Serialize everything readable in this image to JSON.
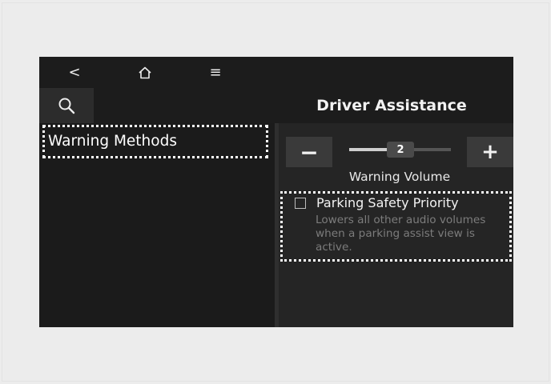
{
  "nav": {
    "back_icon": "chevron-left-icon",
    "home_icon": "home-icon",
    "menu_icon": "hamburger-menu-icon",
    "back_glyph": "<",
    "menu_glyph": "≡"
  },
  "header": {
    "search_icon": "search-icon",
    "title": "Driver Assistance"
  },
  "sidebar": {
    "items": [
      {
        "label": "Warning Methods",
        "selected": true
      }
    ]
  },
  "volume": {
    "minus_label": "−",
    "plus_label": "+",
    "value": "2",
    "level_fraction": 0.5,
    "label": "Warning Volume"
  },
  "options": {
    "parking_priority": {
      "label": "Parking Safety Priority",
      "checked": false,
      "description": "Lowers all other audio volumes when a parking assist view is active."
    }
  },
  "colors": {
    "screen_bg": "#242424",
    "bar_bg": "#1c1c1c",
    "text": "#f2f2f2",
    "muted_text": "#7c7c7c",
    "highlight_border": "#ffffff"
  }
}
